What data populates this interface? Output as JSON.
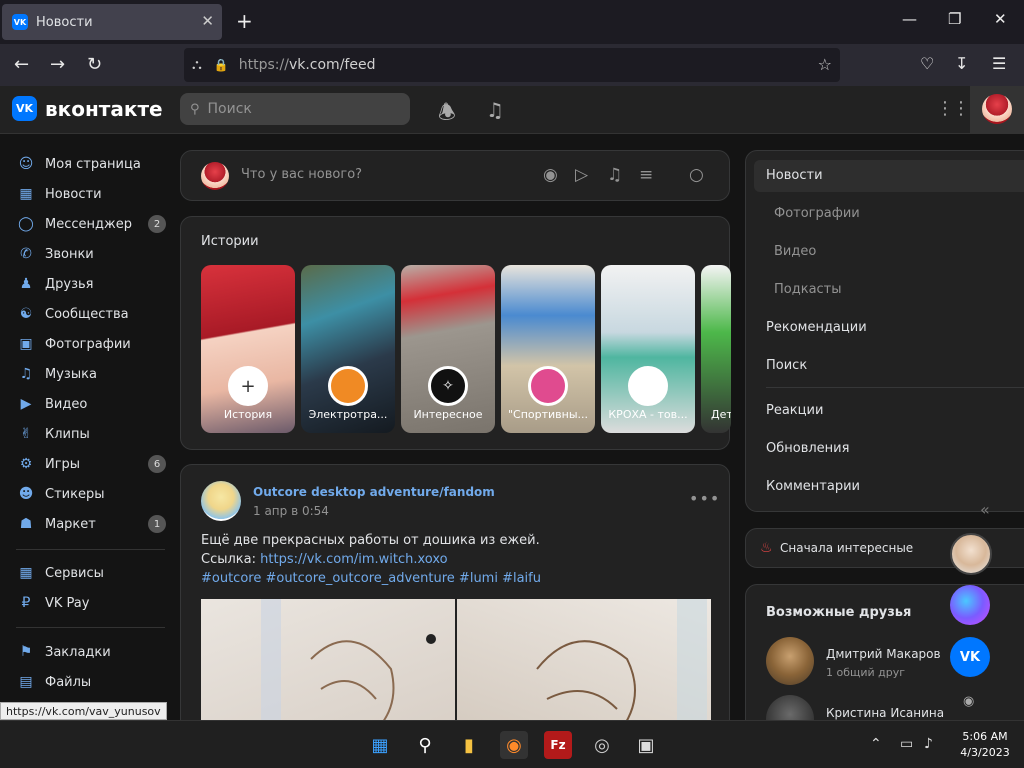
{
  "browser": {
    "tab_title": "Новости",
    "tab_favicon": "VK",
    "close_tab": "✕",
    "new_tab": "+",
    "url_scheme": "https://",
    "url_host": "vk.com/feed",
    "status_url": "https://vk.com/vav_yunusov"
  },
  "header": {
    "logo_mark": "VK",
    "logo_text": "вконтакте",
    "search_placeholder": "Поиск"
  },
  "sidebar": {
    "items": [
      {
        "label": "Моя страница",
        "icon": "user-circle-icon"
      },
      {
        "label": "Новости",
        "icon": "news-icon"
      },
      {
        "label": "Мессенджер",
        "icon": "message-icon",
        "badge": "2"
      },
      {
        "label": "Звонки",
        "icon": "phone-icon"
      },
      {
        "label": "Друзья",
        "icon": "friends-icon"
      },
      {
        "label": "Сообщества",
        "icon": "groups-icon"
      },
      {
        "label": "Фотографии",
        "icon": "photo-icon"
      },
      {
        "label": "Музыка",
        "icon": "music-icon"
      },
      {
        "label": "Видео",
        "icon": "video-icon"
      },
      {
        "label": "Клипы",
        "icon": "clips-icon"
      },
      {
        "label": "Игры",
        "icon": "gamepad-icon",
        "badge": "6"
      },
      {
        "label": "Стикеры",
        "icon": "sticker-icon"
      },
      {
        "label": "Маркет",
        "icon": "bag-icon",
        "badge": "1"
      },
      {
        "label": "Сервисы",
        "icon": "services-icon"
      },
      {
        "label": "VK Pay",
        "icon": "pay-icon"
      },
      {
        "label": "Закладки",
        "icon": "bookmark-icon"
      },
      {
        "label": "Файлы",
        "icon": "file-icon"
      }
    ]
  },
  "composer": {
    "placeholder": "Что у вас нового?"
  },
  "stories": {
    "title": "Истории",
    "items": [
      {
        "label": "История"
      },
      {
        "label": "Электротра..."
      },
      {
        "label": "Интересное"
      },
      {
        "label": "\"Спортивны..."
      },
      {
        "label": "КРОХА - тов..."
      },
      {
        "label": "Дет"
      }
    ]
  },
  "post": {
    "author": "Outcore desktop adventure/fandom",
    "date": "1 апр в 0:54",
    "text_line1": "Ещё две прекрасных работы от дошика из ежей.",
    "text_link_prefix": "Ссылка: ",
    "text_link": "https://vk.com/im.witch.xoxo",
    "hashtags": "#outcore #outcore_outcore_adventure #lumi #laifu"
  },
  "rightmenu": {
    "items": [
      {
        "label": "Новости"
      },
      {
        "label": "Фотографии"
      },
      {
        "label": "Видео"
      },
      {
        "label": "Подкасты"
      },
      {
        "label": "Рекомендации"
      },
      {
        "label": "Поиск"
      },
      {
        "label": "Реакции"
      },
      {
        "label": "Обновления"
      },
      {
        "label": "Комментарии"
      }
    ]
  },
  "sort": {
    "label": "Сначала интересные"
  },
  "friends": {
    "title": "Возможные друзья",
    "items": [
      {
        "name": "Дмитрий Макаров",
        "meta": "1 общий друг"
      },
      {
        "name": "Кристина Исанина"
      }
    ]
  },
  "taskbar": {
    "time": "5:06 AM",
    "date": "4/3/2023"
  }
}
